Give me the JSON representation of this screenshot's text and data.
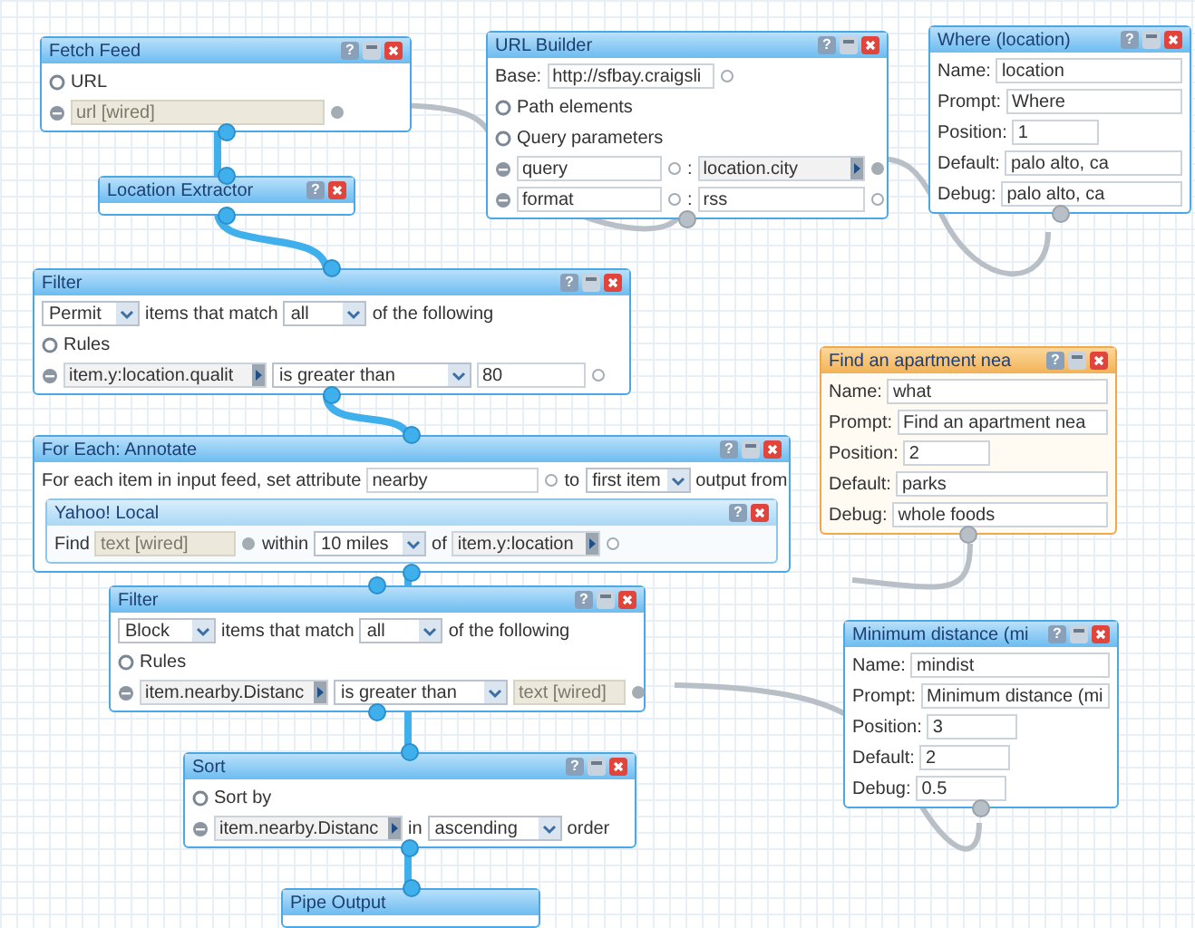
{
  "modules": [
    {
      "title": "Fetch Feed",
      "selected": false,
      "buttons": [
        {
          "kind": "help",
          "glyph": "?"
        },
        {
          "kind": "minimize"
        },
        {
          "kind": "close"
        }
      ],
      "rows": [
        {
          "parts": [
            {
              "kind": "section",
              "label": "URL"
            }
          ]
        },
        {
          "parts": [
            {
              "kind": "remove"
            },
            {
              "kind": "input",
              "placeholder": "url [wired]"
            },
            {
              "kind": "terminal",
              "connected": true
            }
          ]
        }
      ]
    },
    {
      "title": "URL Builder",
      "selected": false,
      "buttons": [
        {
          "kind": "help",
          "glyph": "?"
        },
        {
          "kind": "minimize"
        },
        {
          "kind": "close"
        }
      ],
      "rows": [
        {
          "parts": [
            {
              "kind": "label",
              "text": "Base:"
            },
            {
              "kind": "input",
              "value": "http://sfbay.craigsli"
            },
            {
              "kind": "terminal",
              "connected": false
            }
          ]
        },
        {
          "parts": [
            {
              "kind": "section",
              "label": "Path elements"
            }
          ]
        },
        {
          "parts": [
            {
              "kind": "section",
              "label": "Query parameters"
            }
          ]
        },
        {
          "parts": [
            {
              "kind": "remove"
            },
            {
              "kind": "input",
              "value": "query"
            },
            {
              "kind": "terminal",
              "connected": false
            },
            {
              "kind": "label",
              "text": ":"
            },
            {
              "kind": "picker",
              "value": "location.city"
            },
            {
              "kind": "terminal",
              "connected": true
            }
          ]
        },
        {
          "parts": [
            {
              "kind": "remove"
            },
            {
              "kind": "input",
              "value": "format"
            },
            {
              "kind": "terminal",
              "connected": false
            },
            {
              "kind": "label",
              "text": ":"
            },
            {
              "kind": "input",
              "value": "rss"
            },
            {
              "kind": "terminal",
              "connected": false
            }
          ]
        }
      ]
    },
    {
      "title": "Where (location)",
      "selected": false,
      "buttons": [
        {
          "kind": "help",
          "glyph": "?"
        },
        {
          "kind": "minimize"
        },
        {
          "kind": "close"
        }
      ],
      "rows": [
        {
          "parts": [
            {
              "kind": "label",
              "text": "Name:"
            },
            {
              "kind": "input",
              "value": "location"
            }
          ]
        },
        {
          "parts": [
            {
              "kind": "label",
              "text": "Prompt:"
            },
            {
              "kind": "input",
              "value": "Where"
            }
          ]
        },
        {
          "parts": [
            {
              "kind": "label",
              "text": "Position:"
            },
            {
              "kind": "input",
              "value": "1"
            }
          ]
        },
        {
          "parts": [
            {
              "kind": "label",
              "text": "Default:"
            },
            {
              "kind": "input",
              "value": "palo alto, ca"
            }
          ]
        },
        {
          "parts": [
            {
              "kind": "label",
              "text": "Debug:"
            },
            {
              "kind": "input",
              "value": "palo alto, ca"
            }
          ]
        }
      ]
    },
    {
      "title": "Location Extractor",
      "selected": false,
      "buttons": [
        {
          "kind": "help",
          "glyph": "?"
        },
        {
          "kind": "close"
        }
      ]
    },
    {
      "title": "Filter",
      "selected": false,
      "buttons": [
        {
          "kind": "help",
          "glyph": "?"
        },
        {
          "kind": "minimize"
        },
        {
          "kind": "close"
        }
      ],
      "rows": [
        {
          "parts": [
            {
              "kind": "select",
              "value": "Permit"
            },
            {
              "kind": "label",
              "text": "items that match"
            },
            {
              "kind": "select",
              "value": "all"
            },
            {
              "kind": "label",
              "text": "of the following"
            }
          ]
        },
        {
          "parts": [
            {
              "kind": "section",
              "label": "Rules"
            }
          ]
        },
        {
          "parts": [
            {
              "kind": "remove"
            },
            {
              "kind": "picker",
              "value": "item.y:location.qualit"
            },
            {
              "kind": "select",
              "value": "is greater than"
            },
            {
              "kind": "input",
              "value": "80"
            },
            {
              "kind": "terminal",
              "connected": false
            }
          ]
        }
      ]
    },
    {
      "title": "Find an apartment nea",
      "selected": true,
      "buttons": [
        {
          "kind": "help",
          "glyph": "?"
        },
        {
          "kind": "minimize"
        },
        {
          "kind": "close"
        }
      ],
      "rows": [
        {
          "parts": [
            {
              "kind": "label",
              "text": "Name:"
            },
            {
              "kind": "input",
              "value": "what"
            }
          ]
        },
        {
          "parts": [
            {
              "kind": "label",
              "text": "Prompt:"
            },
            {
              "kind": "input",
              "value": "Find an apartment nea"
            }
          ]
        },
        {
          "parts": [
            {
              "kind": "label",
              "text": "Position:"
            },
            {
              "kind": "input",
              "value": "2"
            }
          ]
        },
        {
          "parts": [
            {
              "kind": "label",
              "text": "Default:"
            },
            {
              "kind": "input",
              "value": "parks"
            }
          ]
        },
        {
          "parts": [
            {
              "kind": "label",
              "text": "Debug:"
            },
            {
              "kind": "input",
              "value": "whole foods"
            }
          ]
        }
      ]
    },
    {
      "title": "For Each: Annotate",
      "selected": false,
      "buttons": [
        {
          "kind": "help",
          "glyph": "?"
        },
        {
          "kind": "minimize"
        },
        {
          "kind": "close"
        }
      ],
      "rows": [
        {
          "parts": [
            {
              "kind": "label",
              "text": "For each item in input feed, set attribute"
            },
            {
              "kind": "input",
              "value": "nearby"
            },
            {
              "kind": "terminal",
              "connected": false
            },
            {
              "kind": "label",
              "text": "to"
            },
            {
              "kind": "select",
              "value": "first item"
            },
            {
              "kind": "label",
              "text": "output from"
            }
          ]
        }
      ],
      "children": [
        {
          "title": "Yahoo! Local",
          "selected": false,
          "buttons": [
            {
              "kind": "help",
              "glyph": "?"
            },
            {
              "kind": "close"
            }
          ],
          "rows": [
            {
              "parts": [
                {
                  "kind": "label",
                  "text": "Find"
                },
                {
                  "kind": "input",
                  "placeholder": "text [wired]"
                },
                {
                  "kind": "terminal",
                  "connected": true
                },
                {
                  "kind": "label",
                  "text": "within"
                },
                {
                  "kind": "select",
                  "value": "10 miles"
                },
                {
                  "kind": "label",
                  "text": "of"
                },
                {
                  "kind": "picker",
                  "value": "item.y:location"
                },
                {
                  "kind": "terminal",
                  "connected": false
                }
              ]
            }
          ]
        }
      ]
    },
    {
      "title": "Filter",
      "selected": false,
      "buttons": [
        {
          "kind": "help",
          "glyph": "?"
        },
        {
          "kind": "minimize"
        },
        {
          "kind": "close"
        }
      ],
      "rows": [
        {
          "parts": [
            {
              "kind": "select",
              "value": "Block"
            },
            {
              "kind": "label",
              "text": "items that match"
            },
            {
              "kind": "select",
              "value": "all"
            },
            {
              "kind": "label",
              "text": "of the following"
            }
          ]
        },
        {
          "parts": [
            {
              "kind": "section",
              "label": "Rules"
            }
          ]
        },
        {
          "parts": [
            {
              "kind": "remove"
            },
            {
              "kind": "picker",
              "value": "item.nearby.Distanc"
            },
            {
              "kind": "select",
              "value": "is greater than"
            },
            {
              "kind": "input",
              "placeholder": "text [wired]"
            },
            {
              "kind": "terminal",
              "connected": true
            }
          ]
        }
      ]
    },
    {
      "title": "Minimum distance (mi",
      "selected": false,
      "buttons": [
        {
          "kind": "help",
          "glyph": "?"
        },
        {
          "kind": "minimize"
        },
        {
          "kind": "close"
        }
      ],
      "rows": [
        {
          "parts": [
            {
              "kind": "label",
              "text": "Name:"
            },
            {
              "kind": "input",
              "value": "mindist"
            }
          ]
        },
        {
          "parts": [
            {
              "kind": "label",
              "text": "Prompt:"
            },
            {
              "kind": "input",
              "value": "Minimum distance (mi"
            }
          ]
        },
        {
          "parts": [
            {
              "kind": "label",
              "text": "Position:"
            },
            {
              "kind": "input",
              "value": "3"
            }
          ]
        },
        {
          "parts": [
            {
              "kind": "label",
              "text": "Default:"
            },
            {
              "kind": "input",
              "value": "2"
            }
          ]
        },
        {
          "parts": [
            {
              "kind": "label",
              "text": "Debug:"
            },
            {
              "kind": "input",
              "value": "0.5"
            }
          ]
        }
      ]
    },
    {
      "title": "Sort",
      "selected": false,
      "buttons": [
        {
          "kind": "help",
          "glyph": "?"
        },
        {
          "kind": "minimize"
        },
        {
          "kind": "close"
        }
      ],
      "rows": [
        {
          "parts": [
            {
              "kind": "section",
              "label": "Sort by"
            }
          ]
        },
        {
          "parts": [
            {
              "kind": "remove"
            },
            {
              "kind": "picker",
              "value": "item.nearby.Distanc"
            },
            {
              "kind": "label",
              "text": "in"
            },
            {
              "kind": "select",
              "value": "ascending"
            },
            {
              "kind": "label",
              "text": "order"
            }
          ]
        }
      ]
    },
    {
      "title": "Pipe Output",
      "selected": false
    }
  ]
}
